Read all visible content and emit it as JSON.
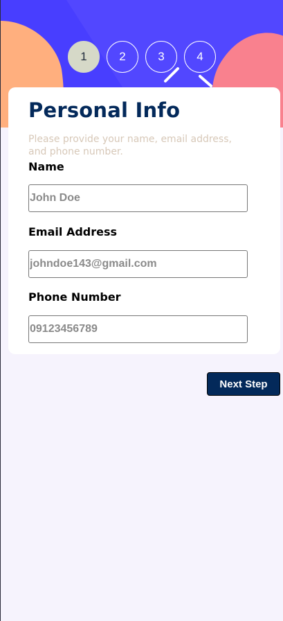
{
  "steps": [
    {
      "number": "1",
      "active": true
    },
    {
      "number": "2",
      "active": false
    },
    {
      "number": "3",
      "active": false
    },
    {
      "number": "4",
      "active": false
    }
  ],
  "form": {
    "title": "Personal Info",
    "subtitle": "Please provide your name, email address, and phone number.",
    "name_label": "Name",
    "name_placeholder": "John Doe",
    "email_label": "Email Address",
    "email_placeholder": "johndoe143@gmail.com",
    "phone_label": "Phone Number",
    "phone_placeholder": "09123456789"
  },
  "actions": {
    "next_label": "Next Step"
  },
  "colors": {
    "hero_purple": "#483eff",
    "hero_orange": "#ffaf7e",
    "hero_pink": "#f9818e",
    "title_navy": "#03295a",
    "active_step": "#d6d9c8",
    "page_bg": "#f6f3fd"
  }
}
